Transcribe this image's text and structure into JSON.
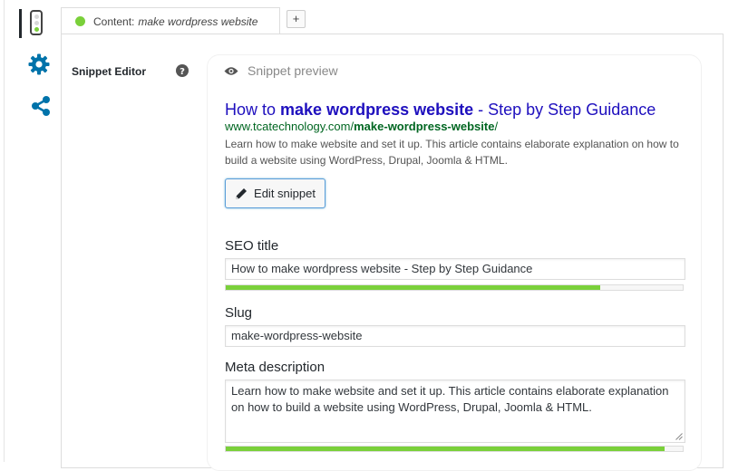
{
  "tab": {
    "label_prefix": "Content:",
    "keyword": "make wordpress website",
    "status_color": "#7ad03a",
    "add_label": "+"
  },
  "editor": {
    "label": "Snippet Editor",
    "help_icon": "question-circle-icon"
  },
  "preview": {
    "heading": "Snippet preview",
    "title_start": "How to ",
    "title_bold": "make wordpress website",
    "title_end": " - Step by Step Guidance",
    "url_base": "www.tcatechnology.com/",
    "url_bold": "make-wordpress-website",
    "url_end": "/",
    "description": "Learn how to make website and set it up. This article contains elaborate explanation on how to build a website using WordPress, Drupal, Joomla & HTML.",
    "edit_button": "Edit snippet"
  },
  "fields": {
    "seo_title_label": "SEO title",
    "seo_title_value": "How to make wordpress website - Step by Step Guidance",
    "seo_title_progress": 0.82,
    "slug_label": "Slug",
    "slug_value": "make-wordpress-website",
    "meta_label": "Meta description",
    "meta_value": "Learn how to make website and set it up. This article contains elaborate explanation on how to build a website using WordPress, Drupal, Joomla & HTML.",
    "meta_progress": 0.96
  },
  "colors": {
    "accent_green": "#7ad03a",
    "link_blue": "#1e0fbe",
    "url_green": "#006621",
    "icon_blue": "#0073aa"
  },
  "sidebar_icons": [
    "traffic-light-icon",
    "gear-icon",
    "share-icon"
  ]
}
